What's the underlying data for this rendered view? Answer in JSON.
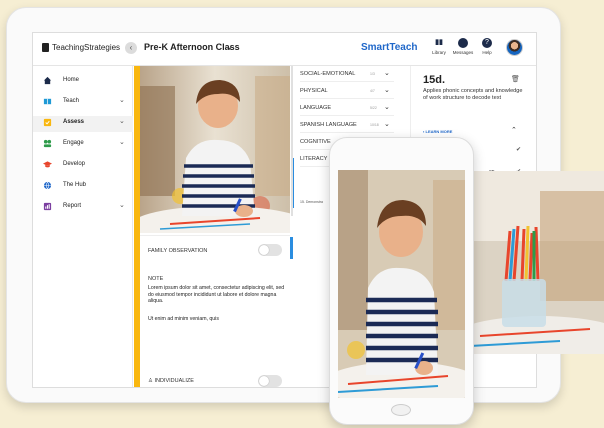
{
  "app": {
    "logo_text": "TeachingStrategies",
    "class_name": "Pre-K Afternoon Class",
    "brand": "SmartTeach",
    "top_icons": [
      {
        "icon": "library-icon",
        "label": "Library",
        "glyph": "▮▮"
      },
      {
        "icon": "messages-icon",
        "label": "Messages",
        "glyph": "●"
      },
      {
        "icon": "help-icon",
        "label": "Help",
        "glyph": "?"
      }
    ]
  },
  "sidebar": {
    "items": [
      {
        "label": "Home",
        "icon": "home-icon",
        "color": "#1c2b4a",
        "chevron": false,
        "active": false
      },
      {
        "label": "Teach",
        "icon": "book-icon",
        "color": "#1f9ad6",
        "chevron": true,
        "active": false
      },
      {
        "label": "Assess",
        "icon": "assess-icon",
        "color": "#f9b70f",
        "chevron": true,
        "active": true
      },
      {
        "label": "Engage",
        "icon": "engage-icon",
        "color": "#2e9b4a",
        "chevron": true,
        "active": false
      },
      {
        "label": "Develop",
        "icon": "graduation-cap-icon",
        "color": "#e8452c",
        "chevron": false,
        "active": false
      },
      {
        "label": "The Hub",
        "icon": "globe-icon",
        "color": "#1f67c9",
        "chevron": false,
        "active": false
      },
      {
        "label": "Report",
        "icon": "report-icon",
        "color": "#7b3fa0",
        "chevron": true,
        "active": false
      }
    ]
  },
  "observation": {
    "family_label": "FAMILY OBSERVATION",
    "note_title": "NOTE",
    "note_body": "Lorem ipsum dolor sit amet, consectetur adipiscing elit, sed do eiusmod tempor incididunt ut labore et dolore magna aliqua.",
    "note_body2": "Ut enim ad minim veniam, quis",
    "individualize_label": "INDIVIDUALIZE"
  },
  "domains": [
    {
      "label": "SOCIAL-EMOTIONAL",
      "count": "1/3"
    },
    {
      "label": "PHYSICAL",
      "count": "4/7"
    },
    {
      "label": "LANGUAGE",
      "count": "5/22"
    },
    {
      "label": "SPANISH LANGUAGE",
      "count": "10/18"
    },
    {
      "label": "COGNITIVE",
      "count": ""
    },
    {
      "label": "LITERACY",
      "count": ""
    }
  ],
  "domain_sub": "15. Demonstra",
  "detail": {
    "code": "15d.",
    "description": "Applies phonic concepts and knowledge of work structure to decode text",
    "learn_more": "LEARN MORE",
    "on_text": "on"
  },
  "colors": {
    "accent_yellow": "#f9b70f",
    "accent_blue": "#1f67c9",
    "navy": "#1c2b4a"
  }
}
